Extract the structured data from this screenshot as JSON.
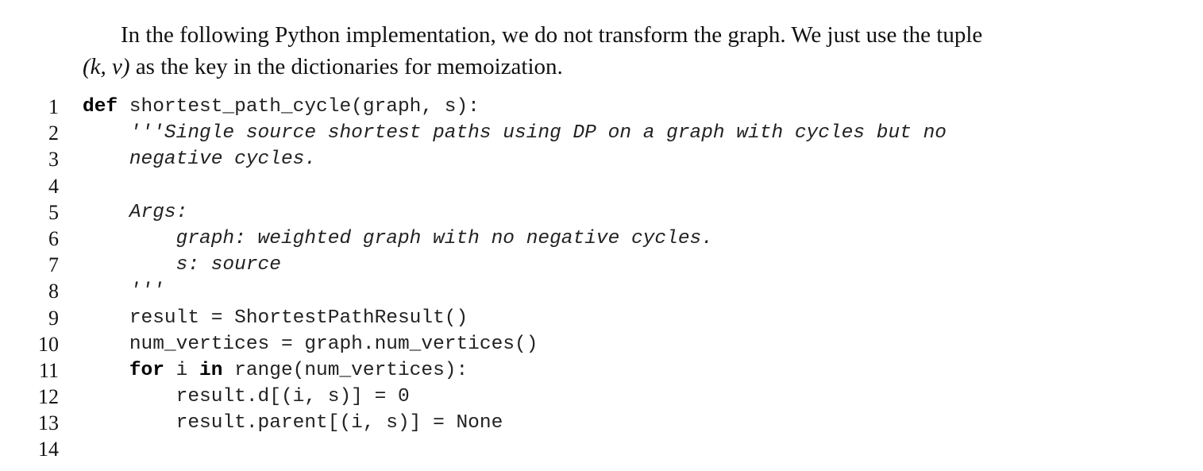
{
  "intro": {
    "line1": "In the following Python implementation, we do not transform the graph. We just use the tuple",
    "math": "(k, v)",
    "line2_rest": " as the key in the dictionaries for memoization."
  },
  "code_lines": [
    {
      "num": "1",
      "indent": "",
      "kw": "def",
      "text": " shortest_path_cycle(graph, s):",
      "style": "plain"
    },
    {
      "num": "2",
      "indent": "    ",
      "kw": "",
      "text": "'''Single source shortest paths using DP on a graph with cycles but no",
      "style": "doc"
    },
    {
      "num": "3",
      "indent": "    ",
      "kw": "",
      "text": "negative cycles.",
      "style": "doc"
    },
    {
      "num": "4",
      "indent": "",
      "kw": "",
      "text": "",
      "style": "plain"
    },
    {
      "num": "5",
      "indent": "    ",
      "kw": "",
      "text": "Args:",
      "style": "doc"
    },
    {
      "num": "6",
      "indent": "        ",
      "kw": "",
      "text": "graph: weighted graph with no negative cycles.",
      "style": "doc"
    },
    {
      "num": "7",
      "indent": "        ",
      "kw": "",
      "text": "s: source",
      "style": "doc"
    },
    {
      "num": "8",
      "indent": "    ",
      "kw": "",
      "text": "'''",
      "style": "doc"
    },
    {
      "num": "9",
      "indent": "    ",
      "kw": "",
      "text": "result = ShortestPathResult()",
      "style": "plain"
    },
    {
      "num": "10",
      "indent": "    ",
      "kw": "",
      "text": "num_vertices = graph.num_vertices()",
      "style": "plain"
    },
    {
      "num": "11",
      "indent": "    ",
      "kw": "for",
      "text": " i ",
      "kw2": "in",
      "text2": " range(num_vertices):",
      "style": "plain"
    },
    {
      "num": "12",
      "indent": "        ",
      "kw": "",
      "text": "result.d[(i, s)] = 0",
      "style": "plain"
    },
    {
      "num": "13",
      "indent": "        ",
      "kw": "",
      "text": "result.parent[(i, s)] = None",
      "style": "plain"
    },
    {
      "num": "14",
      "indent": "",
      "kw": "",
      "text": "",
      "style": "plain"
    }
  ]
}
